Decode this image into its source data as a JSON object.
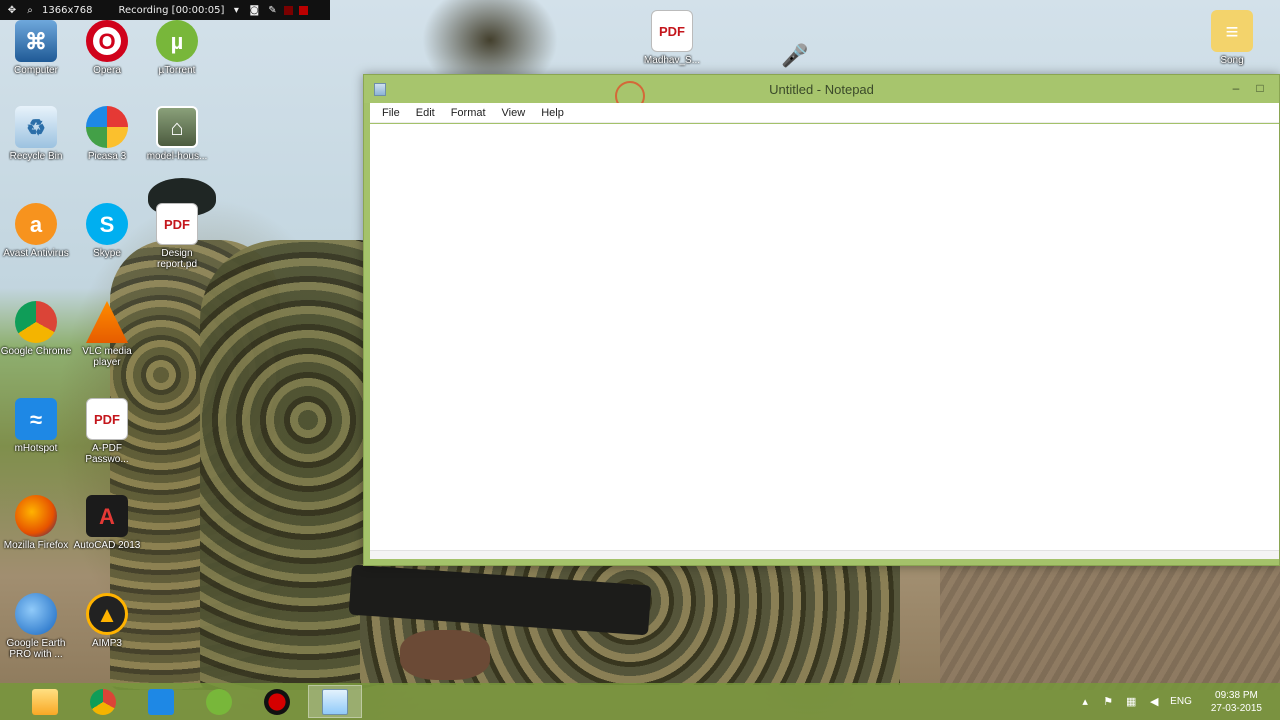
{
  "recorder": {
    "resolution": "1366x768",
    "status": "Recording [00:00:05]"
  },
  "desktop_icons": [
    {
      "label": "Computer",
      "glyph": "⌘"
    },
    {
      "label": "Opera",
      "glyph": "O"
    },
    {
      "label": "µTorrent",
      "glyph": "µ"
    },
    {
      "label": "Recycle Bin",
      "glyph": "♻"
    },
    {
      "label": "Picasa 3",
      "glyph": ""
    },
    {
      "label": "model-hous...",
      "glyph": "⌂"
    },
    {
      "label": "Avast Antivirus",
      "glyph": "a"
    },
    {
      "label": "Skype",
      "glyph": "S"
    },
    {
      "label": "Design report.pd",
      "glyph": "PDF"
    },
    {
      "label": "Google Chrome",
      "glyph": ""
    },
    {
      "label": "VLC media player",
      "glyph": ""
    },
    {
      "label": "mHotspot",
      "glyph": "≈"
    },
    {
      "label": "A-PDF Passwo...",
      "glyph": "PDF"
    },
    {
      "label": "Mozilla Firefox",
      "glyph": ""
    },
    {
      "label": "AutoCAD 2013",
      "glyph": "A"
    },
    {
      "label": "Google Earth PRO with ...",
      "glyph": ""
    },
    {
      "label": "AIMP3",
      "glyph": "▲"
    },
    {
      "label": "Madhav_S...",
      "glyph": "PDF"
    },
    {
      "label": "Song",
      "glyph": "≡"
    }
  ],
  "notepad": {
    "title": "Untitled - Notepad",
    "menu": [
      "File",
      "Edit",
      "Format",
      "View",
      "Help"
    ],
    "content": "",
    "minimize_glyph": "–",
    "maximize_glyph": "□"
  },
  "taskbar": {
    "apps": [
      "File Explorer",
      "Google Chrome",
      "mHotspot",
      "µTorrent",
      "Screen Recorder",
      "Notepad"
    ],
    "tray": {
      "language": "ENG",
      "time": "09:38 PM",
      "date": "27-03-2015",
      "chevron": "▴",
      "flag_glyph": "⚑",
      "network_glyph": "▦",
      "volume_glyph": "◀"
    }
  }
}
